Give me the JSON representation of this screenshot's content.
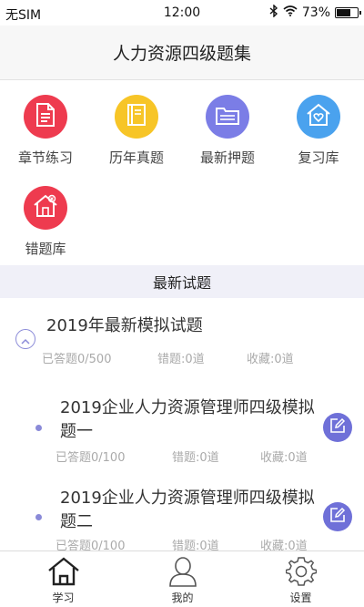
{
  "status_bar": {
    "carrier": "无SIM",
    "time": "12:00",
    "battery": "73%",
    "battery_level": 0.73
  },
  "header": {
    "title": "人力资源四级题集"
  },
  "menu": [
    {
      "label": "章节练习",
      "icon": "document-icon",
      "color": "#ee3b4f"
    },
    {
      "label": "历年真题",
      "icon": "book-icon",
      "color": "#f7c527"
    },
    {
      "label": "最新押题",
      "icon": "folder-icon",
      "color": "#7b7de6"
    },
    {
      "label": "复习库",
      "icon": "heart-house-icon",
      "color": "#4aa2ee"
    },
    {
      "label": "错题库",
      "icon": "error-house-icon",
      "color": "#ee3b4f"
    }
  ],
  "section": {
    "title": "最新试题"
  },
  "exam_group": {
    "title": "2019年最新模拟试题",
    "answered": "已答题0/500",
    "wrong": "错题:0道",
    "favorites": "收藏:0道",
    "items": [
      {
        "title": "2019企业人力资源管理师四级模拟题一",
        "answered": "已答题0/100",
        "wrong": "错题:0道",
        "favorites": "收藏:0道"
      },
      {
        "title": "2019企业人力资源管理师四级模拟题二",
        "answered": "已答题0/100",
        "wrong": "错题:0道",
        "favorites": "收藏:0道"
      }
    ]
  },
  "tabs": [
    {
      "label": "学习",
      "icon": "home-icon",
      "active": true
    },
    {
      "label": "我的",
      "icon": "user-icon",
      "active": false
    },
    {
      "label": "设置",
      "icon": "gear-icon",
      "active": false
    }
  ],
  "colors": {
    "accent": "#6f70d8",
    "section_bg": "#f0f0f8",
    "muted_text": "#aaaaaa"
  }
}
